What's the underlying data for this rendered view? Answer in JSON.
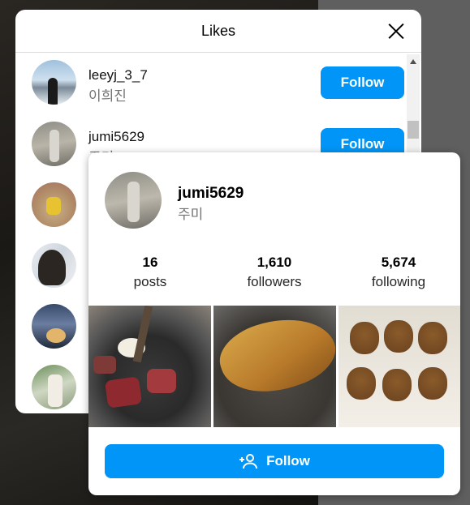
{
  "background": {
    "side_text": ""
  },
  "likes_modal": {
    "title": "Likes",
    "rows": [
      {
        "username": "leeyj_3_7",
        "fullname": "이희진",
        "button": "Follow"
      },
      {
        "username": "jumi5629",
        "fullname": "주미",
        "button": "Follow"
      },
      {
        "username": "",
        "fullname": "",
        "button": ""
      },
      {
        "username": "",
        "fullname": "",
        "button": ""
      },
      {
        "username": "",
        "fullname": "",
        "button": ""
      },
      {
        "username": "",
        "fullname": "",
        "button": ""
      }
    ]
  },
  "hover_card": {
    "username": "jumi5629",
    "fullname": "주미",
    "stats": [
      {
        "value": "16",
        "label": "posts"
      },
      {
        "value": "1,610",
        "label": "followers"
      },
      {
        "value": "5,674",
        "label": "following"
      }
    ],
    "follow_label": "Follow"
  },
  "colors": {
    "accent": "#0095f6",
    "muted_text": "#737373"
  },
  "icons": [
    "close-icon",
    "scroll-up-icon",
    "user-plus-icon"
  ]
}
